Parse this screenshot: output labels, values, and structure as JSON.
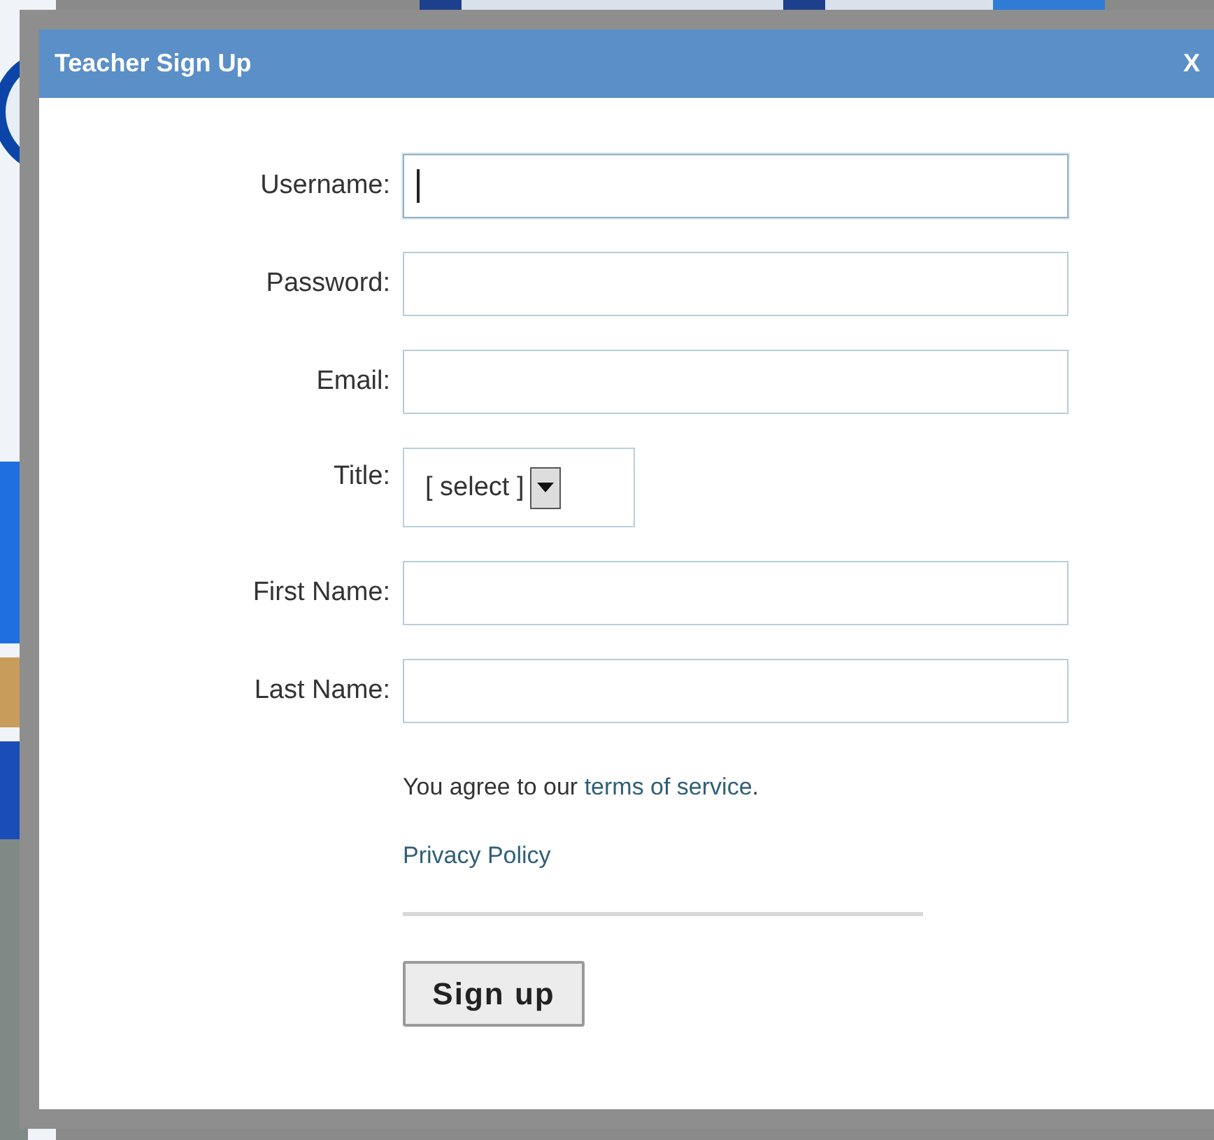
{
  "dialog": {
    "title": "Teacher Sign Up",
    "close": "X"
  },
  "fields": [
    {
      "kind": "text",
      "label": "Username:",
      "focused": true
    },
    {
      "kind": "text",
      "label": "Password:",
      "focused": false
    },
    {
      "kind": "text",
      "label": "Email:",
      "focused": false
    },
    {
      "kind": "select",
      "label": "Title:",
      "value": "[ select ]",
      "focused": false
    },
    {
      "kind": "text",
      "label": "First Name:",
      "focused": false
    },
    {
      "kind": "text",
      "label": "Last Name:",
      "focused": false
    }
  ],
  "agreement": {
    "before": "You agree to our ",
    "link": "terms of service",
    "after": "."
  },
  "privacy_link": "Privacy Policy",
  "submit": "Sign up"
}
